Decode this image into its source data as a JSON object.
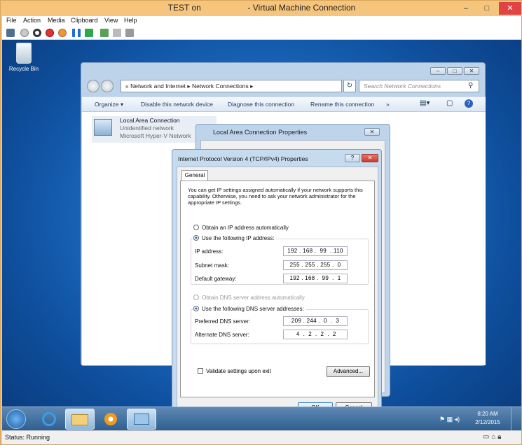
{
  "host": {
    "title": "TEST on                    - Virtual Machine Connection",
    "menu": [
      "File",
      "Action",
      "Media",
      "Clipboard",
      "View",
      "Help"
    ],
    "status": "Status: Running",
    "controls": {
      "minimize": "–",
      "maximize": "□",
      "close": "✕"
    }
  },
  "desktop": {
    "recycle_bin": "Recycle Bin"
  },
  "explorer": {
    "address": "« Network and Internet  ▸  Network Connections  ▸",
    "search_placeholder": "Search Network Connections",
    "commands": [
      "Organize ▾",
      "Disable this network device",
      "Diagnose this connection",
      "Rename this connection",
      "»"
    ],
    "connection": {
      "name": "Local Area Connection",
      "status": "Unidentified network",
      "adapter": "Microsoft Hyper-V Network"
    }
  },
  "lan_properties": {
    "title": "Local Area Connection Properties"
  },
  "ipv4": {
    "title": "Internet Protocol Version 4 (TCP/IPv4) Properties",
    "tab": "General",
    "description": "You can get IP settings assigned automatically if your network supports this capability. Otherwise, you need to ask your network administrator for the appropriate IP settings.",
    "obtain_ip_auto": "Obtain an IP address automatically",
    "use_following_ip": "Use the following IP address:",
    "ip_label": "IP address:",
    "ip_value": "192 . 168 .  99  . 110",
    "mask_label": "Subnet mask:",
    "mask_value": "255 . 255 . 255 .  0",
    "gateway_label": "Default gateway:",
    "gateway_value": "192 . 168 .  99  .  1",
    "obtain_dns_auto": "Obtain DNS server address automatically",
    "use_following_dns": "Use the following DNS server addresses:",
    "pref_dns_label": "Preferred DNS server:",
    "pref_dns_value": "209 . 244 .  0  .  3",
    "alt_dns_label": "Alternate DNS server:",
    "alt_dns_value": " 4  .  2  .  2  .  2",
    "validate": "Validate settings upon exit",
    "advanced": "Advanced...",
    "ok": "OK",
    "cancel": "Cancel"
  },
  "taskbar": {
    "time": "8:20 AM",
    "date": "2/12/2015"
  },
  "colors": {
    "host_frame": "#f5c77e",
    "close_red": "#e04343",
    "desktop_blue": "#1f70c6",
    "aero_glass": "#bcd3ea"
  }
}
